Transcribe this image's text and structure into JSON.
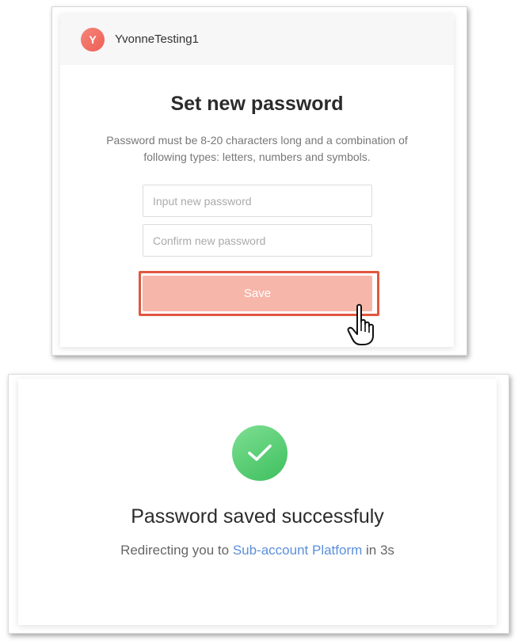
{
  "account": {
    "avatar_letter": "Y",
    "username": "YvonneTesting1"
  },
  "form": {
    "title": "Set new password",
    "hint_line1": "Password must be 8-20 characters long and a combination of",
    "hint_line2": "following types: letters, numbers and symbols.",
    "new_password": {
      "placeholder": "Input new password",
      "value": ""
    },
    "confirm_password": {
      "placeholder": "Confirm new password",
      "value": ""
    },
    "save_label": "Save"
  },
  "success": {
    "title": "Password saved successfuly",
    "redirect_prefix": "Redirecting you to ",
    "redirect_link": "Sub-account Platform",
    "redirect_suffix": " in 3s"
  },
  "icons": {
    "cursor": "pointer-hand-icon",
    "success": "checkmark-icon"
  },
  "colors": {
    "avatar": "#ee5f55",
    "save_button": "#f7b6aa",
    "highlight": "#e1573f",
    "success": "#4cc56a",
    "link": "#5b8fdb"
  }
}
